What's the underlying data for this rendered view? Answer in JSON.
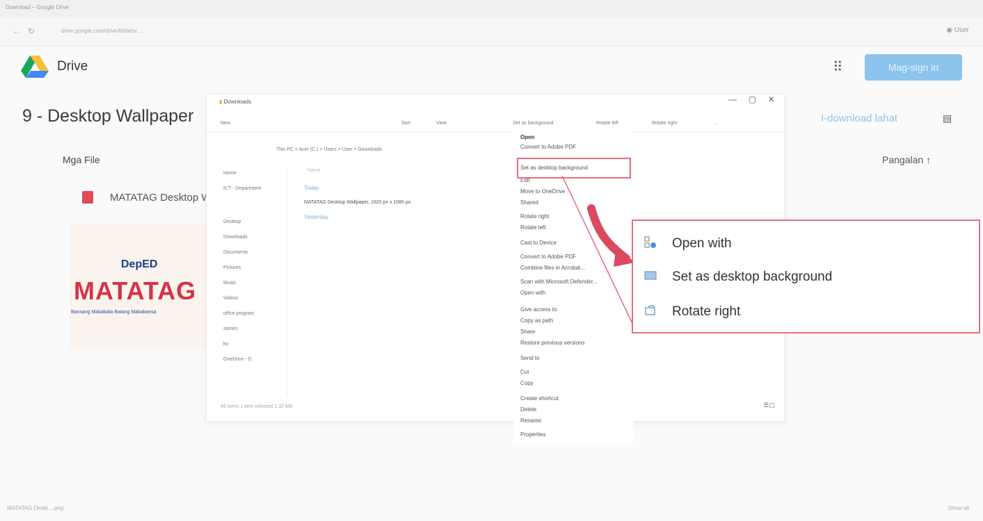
{
  "browser": {
    "tab_title": "Download – Google Drive",
    "url": "drive.google.com/drive/folders/...",
    "account_label": "User"
  },
  "drive": {
    "app_name": "Drive",
    "sign_in_label": "Mag-sign in",
    "folder_title": "9 - Desktop Wallpaper",
    "download_all_label": "I-download lahat",
    "files_label": "Mga File",
    "sort_label": "Pangalan",
    "file_name": "MATATAG Desktop W",
    "thumbnail": {
      "brand": "DepED",
      "title": "MATATAG",
      "tagline": "Bansang Makabata  Batang Makabansa"
    }
  },
  "explorer": {
    "tab_title": "Downloads",
    "toolbar": [
      "New",
      "Sort",
      "View",
      "Set as background",
      "Rotate left",
      "Rotate right",
      "..."
    ],
    "breadcrumb": "This PC  >  Acer (C:)  >  Users  >  User  >  Downloads",
    "column_name": "Name",
    "group_today": "Today",
    "file_row": "MATATAG Desktop Wallpaper, 1920 px x 1080 px",
    "group_yesterday": "Yesterday",
    "sidebar": [
      "Home",
      "ICT - Department",
      "Desktop",
      "Downloads",
      "Documents",
      "Pictures",
      "Music",
      "Videos",
      "office program",
      "stones",
      "ko",
      "OneDrive - D"
    ],
    "status": "48 items    1 item selected  1.32 MB"
  },
  "context_menu": {
    "items": [
      "Open",
      "Convert to Adobe PDF",
      "Set as desktop background",
      "Edit",
      "Move to OneDrive",
      "Shared",
      "Rotate right",
      "Rotate left",
      "Cast to Device",
      "Convert to Adobe PDF",
      "Combine files in Acrobat...",
      "Scan with Microsoft Defender...",
      "Open with",
      "Give access to",
      "Copy as path",
      "Share",
      "Restore previous versions",
      "Send to",
      "Cut",
      "Copy",
      "Create shortcut",
      "Delete",
      "Rename",
      "Properties"
    ]
  },
  "zoom_callout": {
    "items": [
      "Open with",
      "Set as desktop background",
      "Rotate right"
    ]
  },
  "footer": {
    "download_item": "MATATAG Deskt....png",
    "show_all": "Show all"
  },
  "colors": {
    "highlight": "#e86b7c",
    "sign_in_button": "#8cc4ee",
    "matatag_red": "#d5334a",
    "deped_blue": "#1b3d8a"
  }
}
